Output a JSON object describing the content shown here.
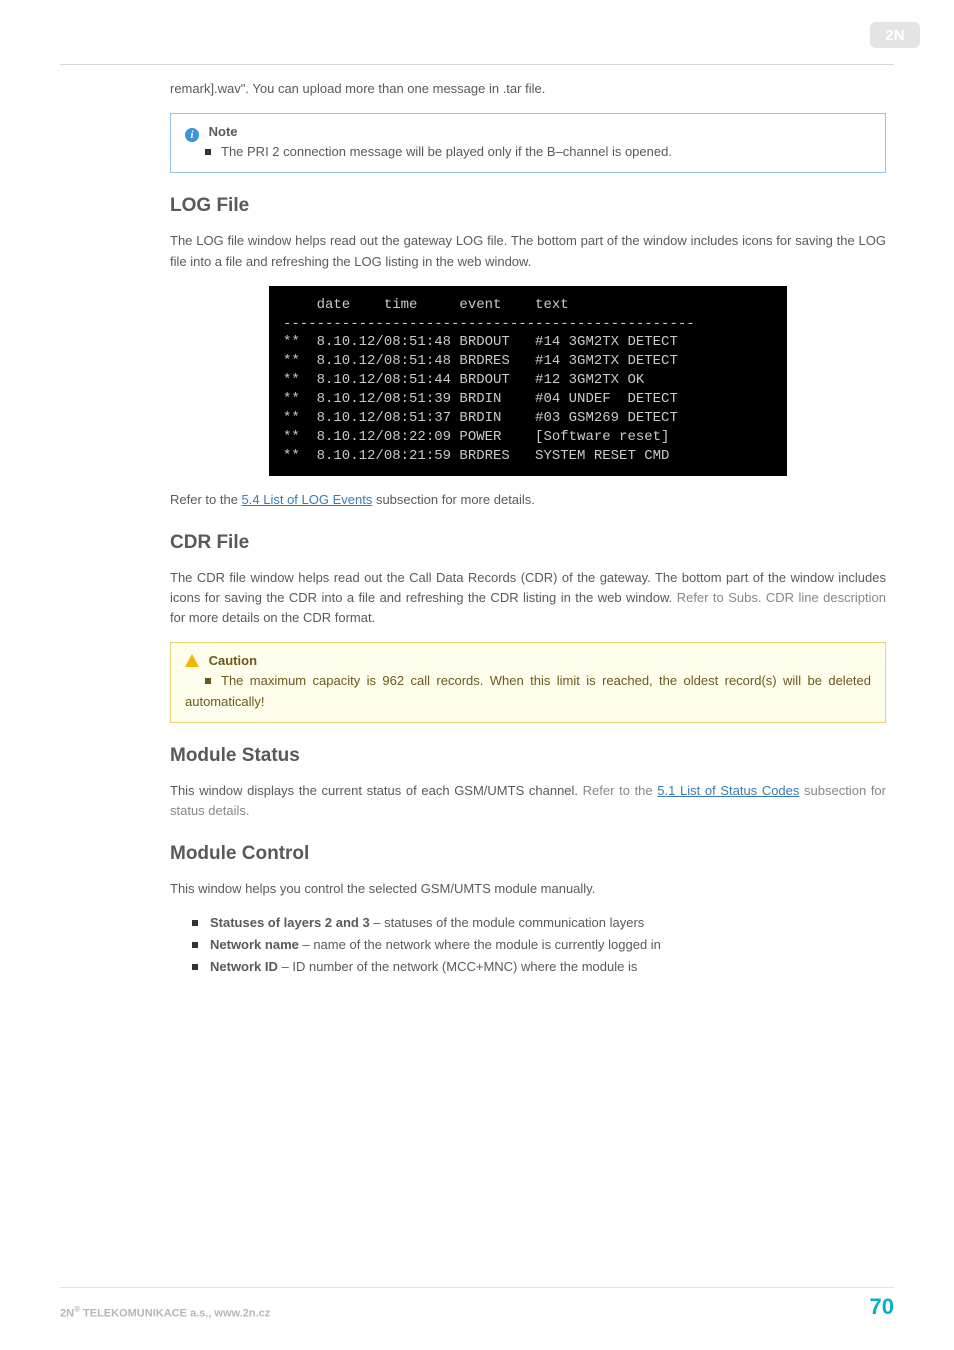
{
  "intro_line": "remark].wav\". You can upload more than one message in .tar file.",
  "note": {
    "title": "Note",
    "body": "The PRI 2 connection message will be played only if the B–channel is opened."
  },
  "sections": {
    "log": {
      "heading": "LOG File",
      "para": "The LOG file window helps read out the gateway LOG file. The bottom part of the window includes icons for saving the LOG file into a file and refreshing the LOG listing in the web window.",
      "terminal": "    date    time     event    text\n-------------------------------------------------\n**  8.10.12/08:51:48 BRDOUT   #14 3GM2TX DETECT\n**  8.10.12/08:51:48 BRDRES   #14 3GM2TX DETECT\n**  8.10.12/08:51:44 BRDOUT   #12 3GM2TX OK\n**  8.10.12/08:51:39 BRDIN    #04 UNDEF  DETECT\n**  8.10.12/08:51:37 BRDIN    #03 GSM269 DETECT\n**  8.10.12/08:22:09 POWER    [Software reset]\n**  8.10.12/08:21:59 BRDRES   SYSTEM RESET CMD",
      "ref_pre": "Refer to the ",
      "ref_link": "5.4 List of LOG Events",
      "ref_post": " subsection for more details."
    },
    "cdr": {
      "heading": "CDR File",
      "para_pre": "The CDR file window helps read out the Call Data Records (CDR) of the gateway. The bottom part of the window includes icons for saving the CDR into a file and refreshing the CDR listing in the web window. ",
      "para_grey": "Refer to Subs. CDR line description",
      "para_post": " for more details on the CDR format."
    },
    "caution": {
      "title": "Caution",
      "body": "The maximum capacity is 962 call records. When this limit is reached, the oldest record(s) will be deleted automatically!"
    },
    "mstatus": {
      "heading": "Module Status",
      "para_pre": "This window displays the current status of each GSM/UMTS channel. ",
      "para_grey": "Refer to the ",
      "para_link": "5.1 List of Status Codes",
      "para_post": " subsection for status details."
    },
    "mcontrol": {
      "heading": "Module Control",
      "para": "This window helps you control the selected GSM/UMTS module manually.",
      "bullets": [
        {
          "b": "Statuses of layers 2 and 3",
          "t": " – statuses of the module communication layers"
        },
        {
          "b": "Network name",
          "t": " – name of the network where the module is currently logged in"
        },
        {
          "b": "Network ID",
          "t": " – ID number of the network (MCC+MNC) where the module is"
        }
      ]
    }
  },
  "footer": {
    "left": "2N® TELEKOMUNIKACE a.s., www.2n.cz",
    "right": "70"
  },
  "chart_data": {
    "type": "table",
    "title": "LOG file listing",
    "columns": [
      "date",
      "time",
      "event",
      "text"
    ],
    "rows": [
      [
        "8.10.12",
        "08:51:48",
        "BRDOUT",
        "#14 3GM2TX DETECT"
      ],
      [
        "8.10.12",
        "08:51:48",
        "BRDRES",
        "#14 3GM2TX DETECT"
      ],
      [
        "8.10.12",
        "08:51:44",
        "BRDOUT",
        "#12 3GM2TX OK"
      ],
      [
        "8.10.12",
        "08:51:39",
        "BRDIN",
        "#04 UNDEF  DETECT"
      ],
      [
        "8.10.12",
        "08:51:37",
        "BRDIN",
        "#03 GSM269 DETECT"
      ],
      [
        "8.10.12",
        "08:22:09",
        "POWER",
        "[Software reset]"
      ],
      [
        "8.10.12",
        "08:21:59",
        "BRDRES",
        "SYSTEM RESET CMD"
      ]
    ]
  }
}
